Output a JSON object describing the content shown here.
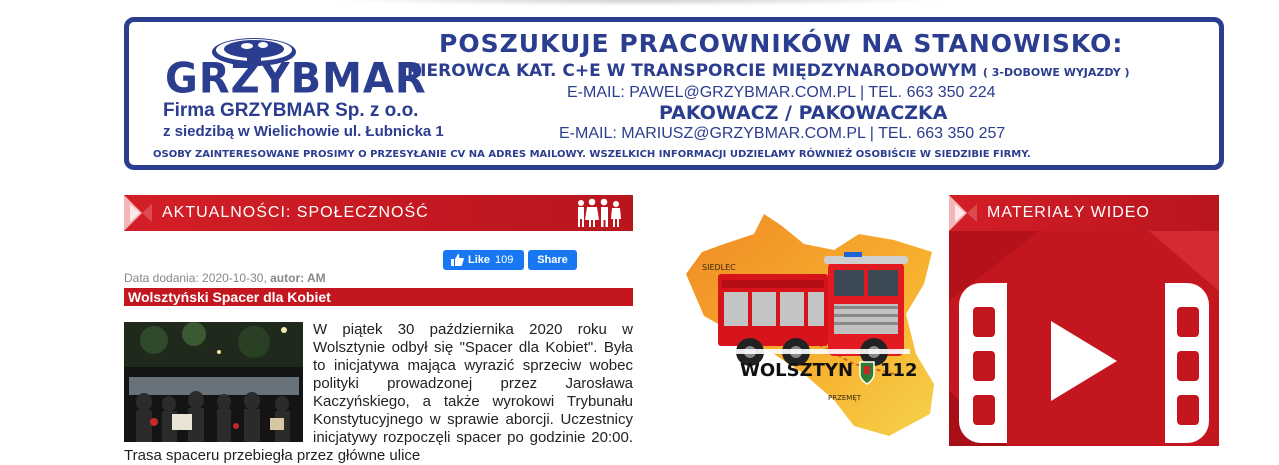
{
  "banner": {
    "logo_text": "GRZYBMAR",
    "firm_name": "Firma GRZYBMAR Sp.  z o.o.",
    "firm_address": "z siedzibą w Wielichowie  ul. Łubnicka 1",
    "headline": "POSZUKUJE PRACOWNIKÓW NA STANOWISKO:",
    "job1": "KIEROWCA KAT. C+E W TRANSPORCIE MIĘDZYNARODOWYM",
    "job1_note": "( 3-DOBOWE WYJAZDY )",
    "job1_contact": "E-MAIL: PAWEL@GRZYBMAR.COM.PL   |   TEL. 663 350 224",
    "job2": "PAKOWACZ / PAKOWACZKA",
    "job2_contact": "E-MAIL: MARIUSZ@GRZYBMAR.COM.PL | TEL. 663 350 257",
    "footer_note": "OSOBY ZAINTERESOWANE PROSIMY O PRZESYŁANIE CV NA ADRES MAILOWY. WSZELKICH INFORMACJI UDZIELAMY RÓWNIEŻ OSOBIŚCIE W SIEDZIBIE FIRMY.",
    "color": "#2b3d8f"
  },
  "news_section": {
    "title": "AKTUALNOŚCI: SPOŁECZNOŚĆ",
    "icon": "people-icon"
  },
  "social": {
    "like_label": "Like",
    "like_count": "109",
    "share_label": "Share"
  },
  "article": {
    "date_prefix": "Data dodania: 2020-10-30, ",
    "author_label": "autor: AM",
    "title": "Wolsztyński Spacer dla Kobiet",
    "body": "W piątek 30 października 2020 roku w Wolsztynie odbył się \"Spacer dla Kobiet\". Była to inicjatywa mająca wyrazić sprzeciw wobec polityki prowadzonej przez Jarosława Kaczyńskiego, a także wyrokowi Trybunału Konstytucyjnego w sprawie aborcji. Uczestnicy inicjatywy rozpoczęli spacer po godzinie 20:00. Trasa spaceru przebiegła przez główne ulice"
  },
  "map_graphic": {
    "place_top": "SIEDLEC",
    "main_text": "WOLSZTYN",
    "number": "112",
    "place_bottom": "PRZEMĘT"
  },
  "video_section": {
    "title": "MATERIAŁY WIDEO",
    "icon": "video-play-icon"
  },
  "colors": {
    "accent_red": "#c4161e",
    "brand_blue": "#2b3d8f",
    "map_orange": "#f5a623",
    "facebook_blue": "#1877f2"
  }
}
